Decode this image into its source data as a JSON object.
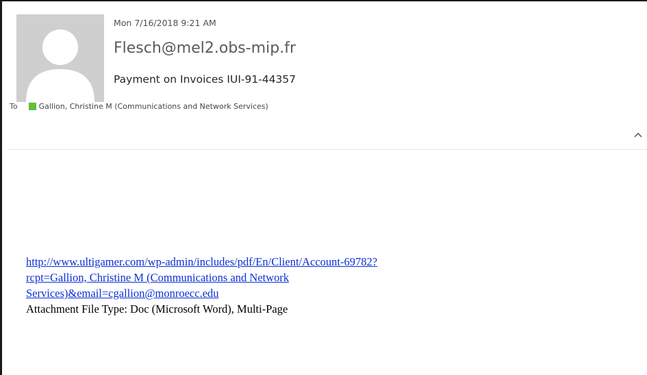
{
  "message": {
    "date": "Mon 7/16/2018 9:21 AM",
    "sender": "Flesch@mel2.obs-mip.fr",
    "subject": "Payment on Invoices IUI-91-44357",
    "to_label": "To",
    "recipient": "Gallion, Christine M (Communications and Network Services)",
    "presence_color": "#5fbf3a",
    "avatar_icon": "person-silhouette-icon",
    "collapse_icon": "chevron-up-icon"
  },
  "body": {
    "link_lines": [
      "http://www.ultigamer.com/wp-admin/includes/pdf/En/Client/Account-69782?",
      "rcpt=Gallion, Christine M (Communications and Network",
      "Services)&email=cgallion@monroecc.edu"
    ],
    "attachment_note": "Attachment File Type: Doc (Microsoft Word), Multi-Page",
    "link_color": "#0b2fd6"
  }
}
